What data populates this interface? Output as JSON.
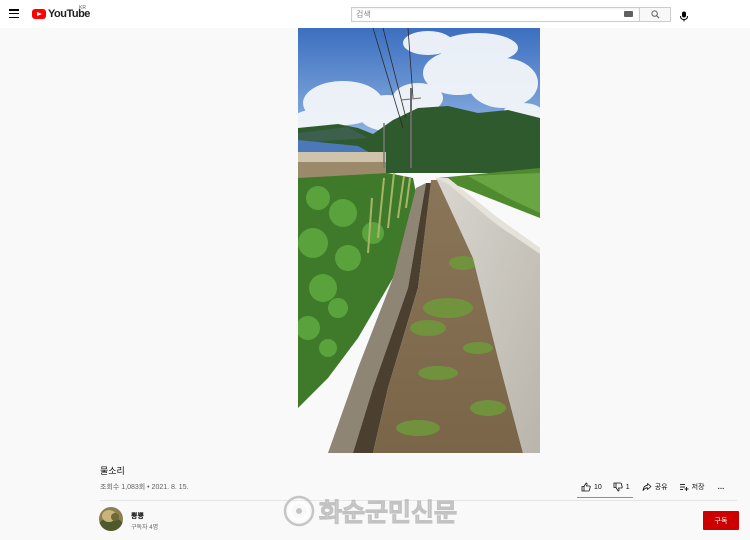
{
  "header": {
    "logo_text": "YouTube",
    "region": "KR",
    "search_placeholder": "검색"
  },
  "video": {
    "title": "물소리",
    "meta": "조회수 1,083회 • 2021. 8. 15."
  },
  "actions": {
    "like_count": "10",
    "dislike_count": "1",
    "share_label": "공유",
    "save_label": "저장",
    "more_label": "…"
  },
  "channel": {
    "name": "뿅뿅",
    "subscribers": "구독자 4명",
    "subscribe_label": "구독"
  },
  "watermark": {
    "text": "화순군민신문"
  },
  "colors": {
    "brand_red": "#ff0000",
    "subscribe_red": "#cc0000",
    "background": "#f9f9f9"
  }
}
